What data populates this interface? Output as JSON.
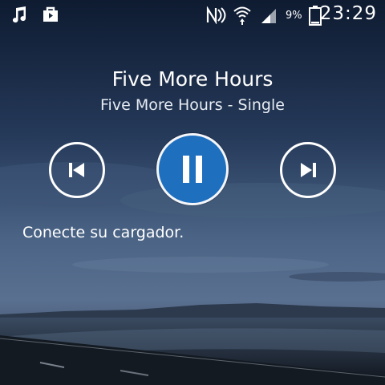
{
  "status_bar": {
    "icons": [
      "music-note-icon",
      "shopping-bag-icon",
      "nfc-icon",
      "wifi-icon",
      "signal-icon",
      "battery-icon"
    ],
    "battery_percent": "9%",
    "time": "23:29"
  },
  "player": {
    "title": "Five More Hours",
    "subtitle": "Five More Hours - Single",
    "controls": {
      "previous": "previous-track",
      "play_pause": "pause",
      "next": "next-track"
    },
    "accent_color": "#1f6fbf"
  },
  "notice": {
    "message": "Conecte su cargador."
  }
}
